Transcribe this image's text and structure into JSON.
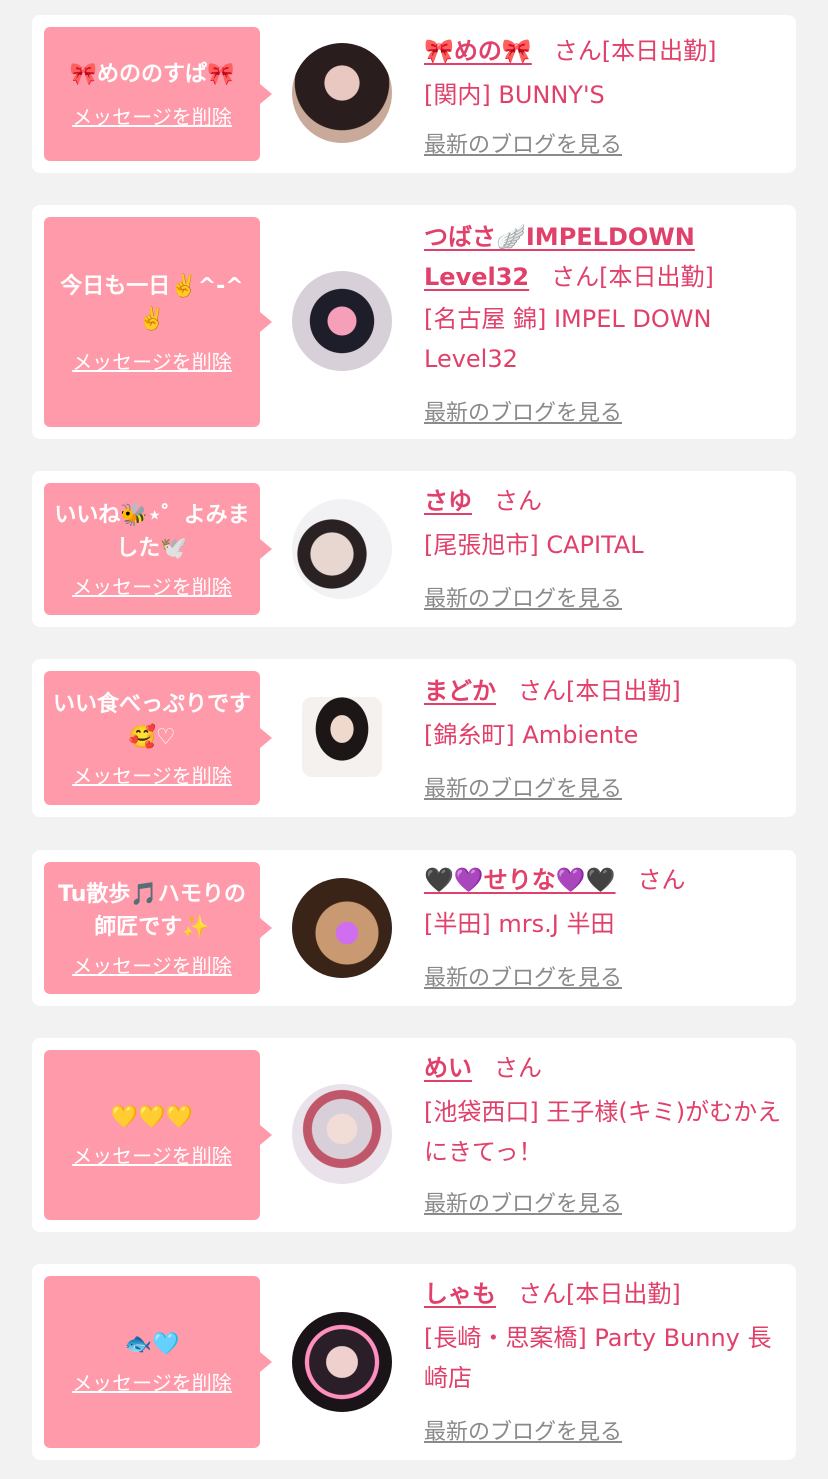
{
  "common": {
    "delete_label": "メッセージを削除",
    "blog_label": "最新のブログを見る",
    "san": "さん"
  },
  "items": [
    {
      "message": "🎀めののすぱ🎀",
      "name": "🎀めの🎀",
      "status": "[本日出勤]",
      "shop": "[関内] BUNNY'S"
    },
    {
      "message": "今日も一日✌️^-^✌️",
      "name": "つばさ🪽IMPELDOWN Level32",
      "status": "[本日出勤]",
      "shop": "[名古屋 錦] IMPEL DOWN Level32"
    },
    {
      "message": "いいね🐝⋆゜よみました🕊️",
      "name": "さゆ",
      "status": "",
      "shop": "[尾張旭市] CAPITAL"
    },
    {
      "message": "いい食べっぷりです🥰♡",
      "name": "まどか",
      "status": "[本日出勤]",
      "shop": "[錦糸町] Ambiente"
    },
    {
      "message": "Tu散歩🎵ハモりの師匠です✨",
      "name": "🖤💜せりな💜🖤",
      "status": "",
      "shop": "[半田] mrs.J 半田"
    },
    {
      "message": "💛💛💛",
      "name": "めい",
      "status": "",
      "shop": "[池袋西口] 王子様(キミ)がむかえにきてっ！"
    },
    {
      "message": "🐟🩵",
      "name": "しゃも",
      "status": "[本日出勤]",
      "shop": "[長崎・思案橋] Party Bunny 長崎店"
    }
  ]
}
